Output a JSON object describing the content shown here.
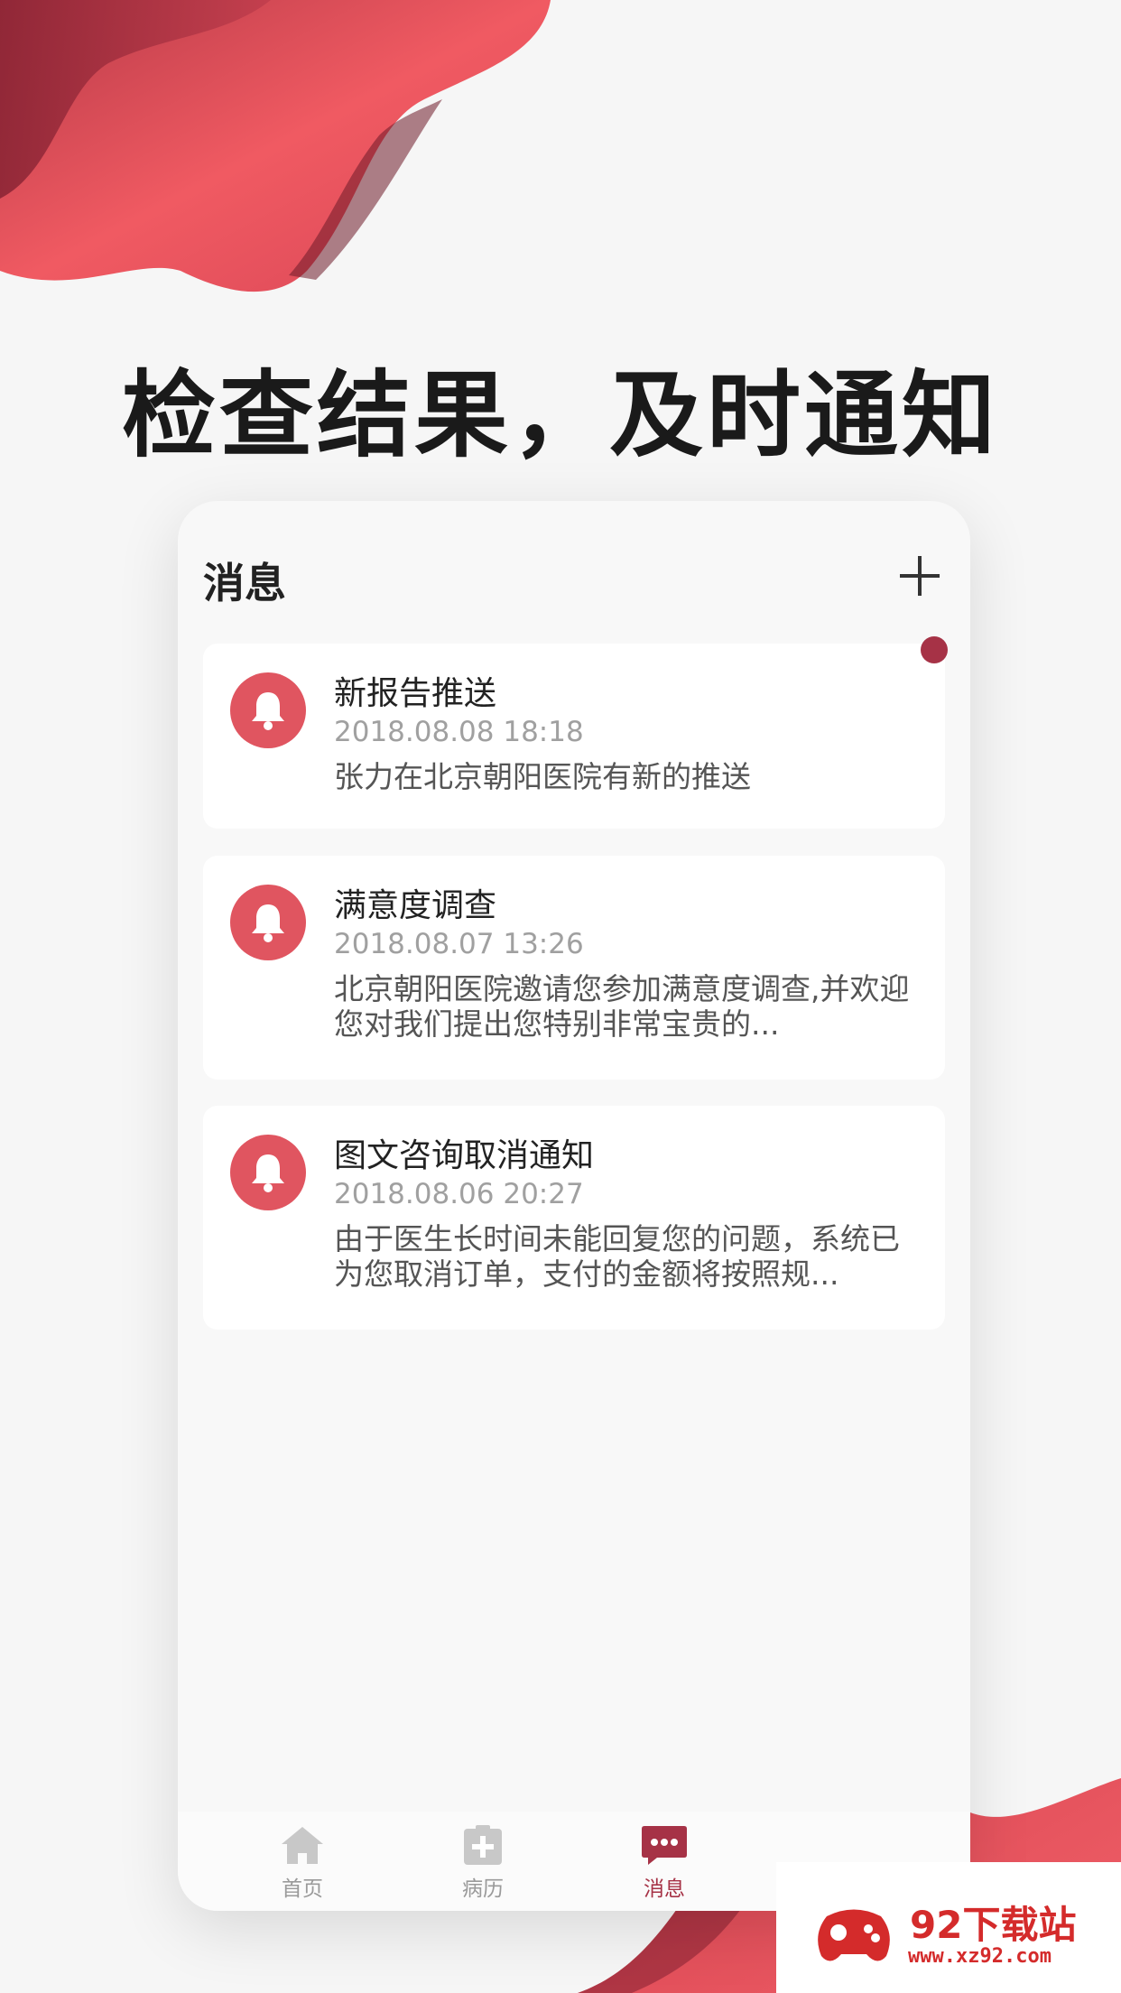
{
  "headline": "检查结果，及时通知",
  "app": {
    "title": "消息",
    "add_icon": "plus-icon"
  },
  "messages": [
    {
      "title": "新报告推送",
      "time": "2018.08.08   18:18",
      "body": "张力在北京朝阳医院有新的推送",
      "icon": "bell-icon"
    },
    {
      "title": "满意度调查",
      "time": "2018.08.07   13:26",
      "body": "北京朝阳医院邀请您参加满意度调查,并欢迎您对我们提出您特别非常宝贵的...",
      "icon": "bell-icon"
    },
    {
      "title": "图文咨询取消通知",
      "time": "2018.08.06   20:27",
      "body": "由于医生长时间未能回复您的问题，系统已为您取消订单，支付的金额将按照规...",
      "icon": "bell-icon"
    }
  ],
  "tabs": [
    {
      "label": "首页",
      "icon": "home-icon",
      "active": false
    },
    {
      "label": "病历",
      "icon": "medical-record-icon",
      "active": false
    },
    {
      "label": "消息",
      "icon": "message-icon",
      "active": true
    }
  ],
  "watermark": {
    "text": "92下载站",
    "url": "www.xz92.com"
  },
  "colors": {
    "accent": "#a63246",
    "bell_bg": "#e05560",
    "blob": "#e0505b"
  }
}
